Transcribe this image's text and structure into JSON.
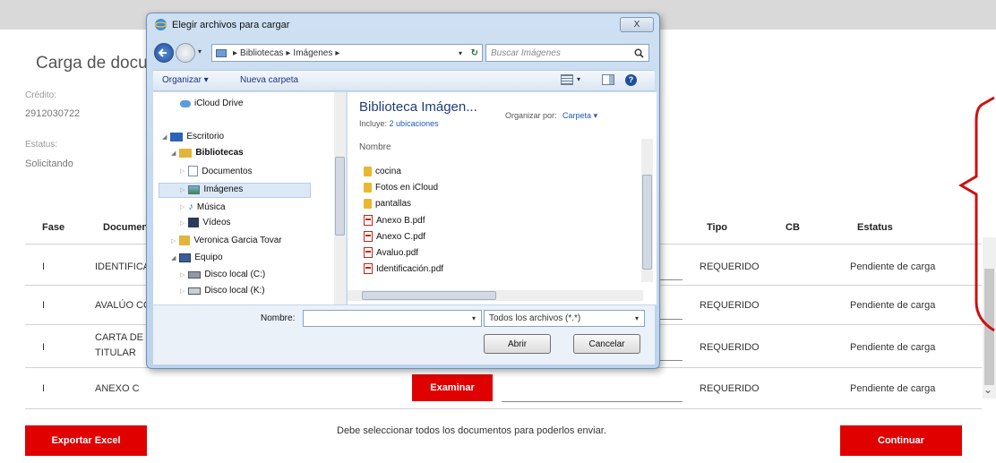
{
  "page": {
    "title": "Carga de documentos",
    "credito_label": "Crédito:",
    "credito_value": "2912030722",
    "estatus_label": "Estatus:",
    "estatus_value": "Solicitando"
  },
  "table": {
    "headers": [
      "Fase",
      "Documento",
      "Tipo",
      "CB",
      "Estatus"
    ],
    "rows": [
      {
        "fase": "I",
        "documento": "IDENTIFICA",
        "tipo": "REQUERIDO",
        "estatus": "Pendiente de carga"
      },
      {
        "fase": "I",
        "documento": "AVALÚO CO",
        "tipo": "REQUERIDO",
        "estatus": "Pendiente de carga"
      },
      {
        "fase": "I",
        "documento": "CARTA DE C",
        "documento2": "TITULAR",
        "tipo": "REQUERIDO",
        "estatus": "Pendiente de carga"
      },
      {
        "fase": "I",
        "documento": "ANEXO C",
        "tipo": "REQUERIDO",
        "estatus": "Pendiente de carga",
        "examinar_label": "Examinar"
      }
    ]
  },
  "footer": {
    "export_label": "Exportar Excel",
    "message": "Debe seleccionar todos los documentos para poderlos enviar.",
    "continue_label": "Continuar"
  },
  "dialog": {
    "title": "Elegir archivos para cargar",
    "close_label": "X",
    "address": [
      "Bibliotecas",
      "Imágenes"
    ],
    "search_placeholder": "Buscar Imágenes",
    "toolbar": {
      "organize": "Organizar ▾",
      "new_folder": "Nueva carpeta"
    },
    "nav_tree": [
      {
        "label": "iCloud Drive",
        "icon": "cloud-icon"
      },
      {
        "label": "Escritorio",
        "icon": "desktop-icon"
      },
      {
        "label": "Bibliotecas",
        "icon": "library-icon"
      },
      {
        "label": "Documentos",
        "icon": "documents-icon"
      },
      {
        "label": "Imágenes",
        "icon": "images-icon",
        "selected": true
      },
      {
        "label": "Música",
        "icon": "music-icon"
      },
      {
        "label": "Vídeos",
        "icon": "video-icon"
      },
      {
        "label": "Veronica Garcia Tovar",
        "icon": "user-folder-icon"
      },
      {
        "label": "Equipo",
        "icon": "computer-icon"
      },
      {
        "label": "Disco local (C:)",
        "icon": "disk-icon"
      },
      {
        "label": "Disco local (K:)",
        "icon": "disk-icon"
      }
    ],
    "library_title": "Biblioteca Imágen...",
    "includes_label": "Incluye:",
    "includes_link": "2 ubicaciones",
    "organize_by_label": "Organizar por:",
    "organize_by_value": "Carpeta ▾",
    "column_header": "Nombre",
    "files": [
      {
        "name": "cocina",
        "type": "folder"
      },
      {
        "name": "Fotos en iCloud",
        "type": "folder"
      },
      {
        "name": "pantallas",
        "type": "folder"
      },
      {
        "name": "Anexo B.pdf",
        "type": "pdf"
      },
      {
        "name": "Anexo C.pdf",
        "type": "pdf"
      },
      {
        "name": "Avaluo.pdf",
        "type": "pdf"
      },
      {
        "name": "Identificación.pdf",
        "type": "pdf"
      }
    ],
    "filename_label": "Nombre:",
    "filename_value": "",
    "filetype_value": "Todos los archivos (*.*)",
    "open_label": "Abrir",
    "cancel_label": "Cancelar"
  },
  "colors": {
    "accent": "#e00000",
    "dialog_link": "#1e3287",
    "dialog_frame": "#bcd3ec"
  }
}
